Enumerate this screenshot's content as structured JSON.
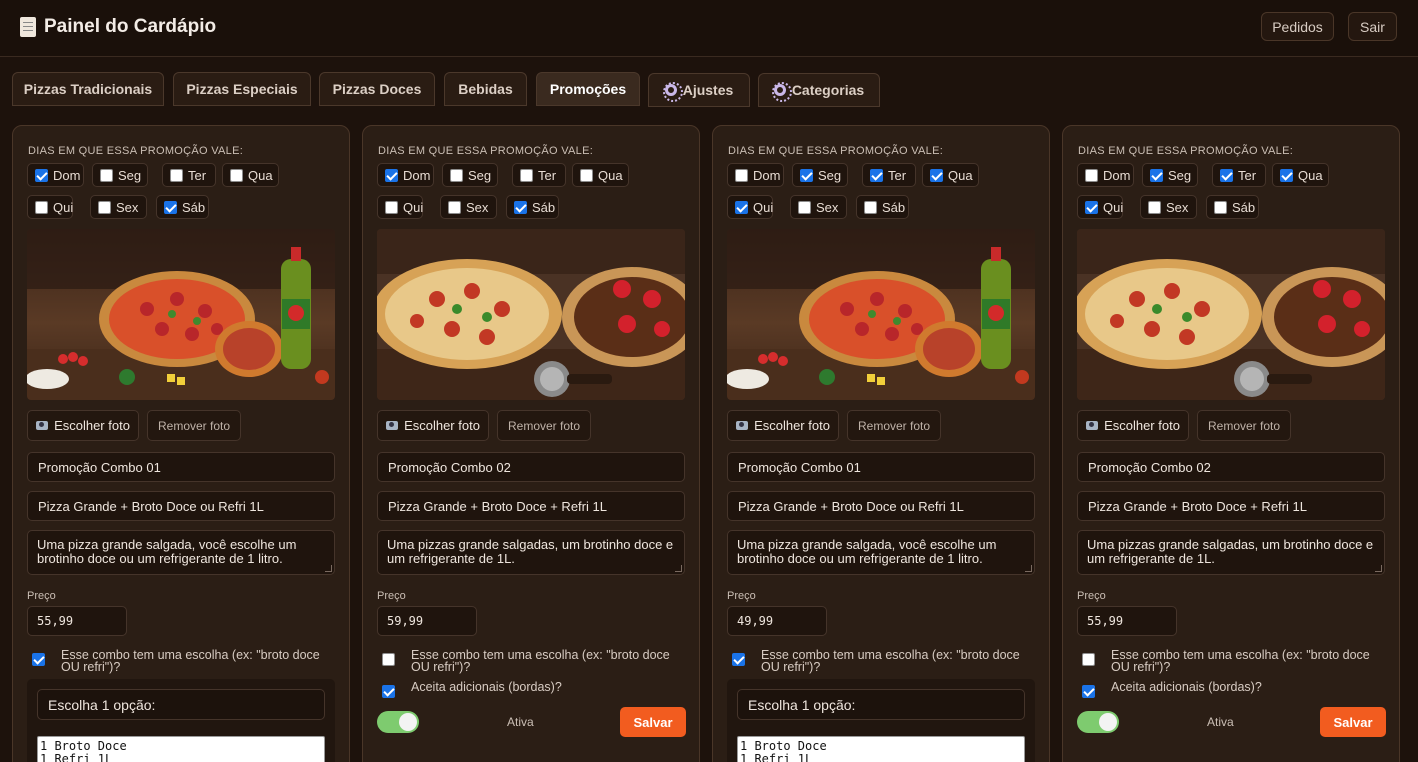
{
  "header": {
    "title": "Painel do Cardápio",
    "icon": "menu-icon",
    "orders_label": "Pedidos",
    "logout_label": "Sair"
  },
  "tabs": [
    {
      "label": "Pizzas Tradicionais"
    },
    {
      "label": "Pizzas Especiais"
    },
    {
      "label": "Pizzas Doces"
    },
    {
      "label": "Bebidas"
    },
    {
      "label": "Promoções",
      "active": true
    },
    {
      "label": "Ajustes",
      "icon": "gear-icon"
    },
    {
      "label": "Categorias",
      "icon": "gear-icon"
    }
  ],
  "labels": {
    "days": "DIAS EM QUE ESSA PROMOÇÃO VALE:",
    "choose_photo": "Escolher foto",
    "remove_photo": "Remover foto",
    "price": "Preço",
    "has_choice": "Esse combo tem uma escolha (ex: \"broto doce OU refri\")?",
    "accepts_addons": "Aceita adicionais (bordas)?",
    "active": "Ativa",
    "save": "Salvar"
  },
  "cards": [
    {
      "days": {
        "Dom": true,
        "Seg": false,
        "Ter": false,
        "Qua": false,
        "Qui": false,
        "Sex": false,
        "Sáb": true
      },
      "photo": "pizza-combo-soda",
      "name": "Promoção Combo 01",
      "subtitle": "Pizza Grande + Broto Doce ou Refri 1L",
      "description": "Uma pizza grande salgada, você escolhe um brotinho doce ou um refrigerante de 1 litro.",
      "price": "55,99",
      "has_choice": true,
      "choice_title": "Escolha 1 opção:",
      "choice_options": [
        "1 Broto Doce",
        "1 Refri 1L"
      ]
    },
    {
      "days": {
        "Dom": true,
        "Seg": false,
        "Ter": false,
        "Qua": false,
        "Qui": false,
        "Sex": false,
        "Sáb": true
      },
      "photo": "pizza-combo-sweet",
      "name": "Promoção Combo 02",
      "subtitle": "Pizza Grande + Broto Doce + Refri 1L",
      "description": "Uma pizzas grande salgadas, um brotinho doce e um refrigerante de 1L.",
      "price": "59,99",
      "has_choice": false,
      "accepts_addons": true,
      "active": true
    },
    {
      "days": {
        "Dom": false,
        "Seg": true,
        "Ter": true,
        "Qua": true,
        "Qui": true,
        "Sex": false,
        "Sáb": false
      },
      "photo": "pizza-combo-soda",
      "name": "Promoção Combo 01",
      "subtitle": "Pizza Grande + Broto Doce ou Refri 1L",
      "description": "Uma pizza grande salgada, você escolhe um brotinho doce ou um refrigerante de 1 litro.",
      "price": "49,99",
      "has_choice": true,
      "choice_title": "Escolha 1 opção:",
      "choice_options": [
        "1 Broto Doce",
        "1 Refri 1L"
      ]
    },
    {
      "days": {
        "Dom": false,
        "Seg": true,
        "Ter": true,
        "Qua": true,
        "Qui": true,
        "Sex": false,
        "Sáb": false
      },
      "photo": "pizza-combo-sweet",
      "name": "Promoção Combo 02",
      "subtitle": "Pizza Grande + Broto Doce + Refri 1L",
      "description": "Uma pizzas grande salgadas, um brotinho doce e um refrigerante de 1L.",
      "price": "55,99",
      "has_choice": false,
      "accepts_addons": true,
      "active": true
    }
  ]
}
